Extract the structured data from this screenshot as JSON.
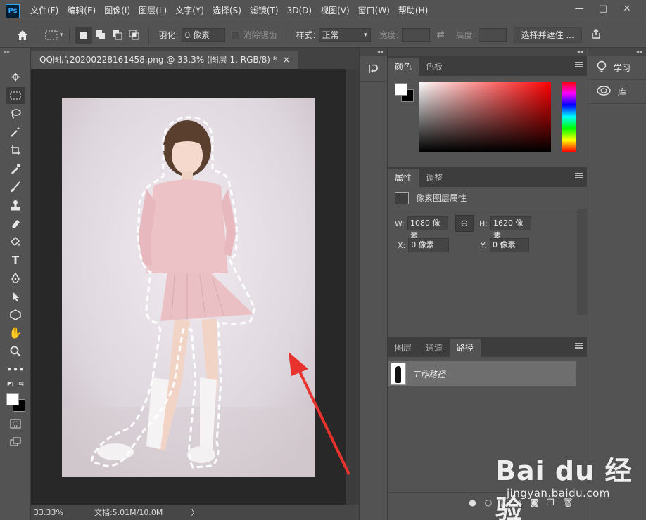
{
  "app": {
    "logo": "Ps",
    "menu": [
      "文件(F)",
      "编辑(E)",
      "图像(I)",
      "图层(L)",
      "文字(Y)",
      "选择(S)",
      "滤镜(T)",
      "3D(D)",
      "视图(V)",
      "窗口(W)",
      "帮助(H)"
    ],
    "window_controls": [
      "—",
      "□",
      "✕"
    ]
  },
  "options": {
    "feather_label": "羽化:",
    "feather_value": "0 像素",
    "antialias_label": "消除锯齿",
    "style_label": "样式:",
    "style_value": "正常",
    "width_label": "宽度:",
    "height_label": "高度:",
    "select_mask_button": "选择并遮住 ..."
  },
  "document": {
    "tab_title": "QQ图片20200228161458.png @ 33.3% (图层 1, RGB/8) *",
    "tab_close": "×",
    "zoom": "33.33%",
    "doc_info": "文档:5.01M/10.0M",
    "status_arrow": "〉"
  },
  "color_panel": {
    "tabs": [
      "颜色",
      "色板"
    ],
    "foreground": "#ffffff",
    "background": "#000000"
  },
  "properties_panel": {
    "tabs": [
      "属性",
      "调整"
    ],
    "header": "像素图层属性",
    "w_label": "W:",
    "w_value": "1080 像素",
    "h_label": "H:",
    "h_value": "1620 像素",
    "x_label": "X:",
    "x_value": "0 像素",
    "y_label": "Y:",
    "y_value": "0 像素"
  },
  "layers_panel": {
    "tabs": [
      "图层",
      "通道",
      "路径"
    ],
    "path_item": "工作路径"
  },
  "side_panel": {
    "learn": "学习",
    "library": "库"
  },
  "watermark": {
    "brand": "Bai du 经验",
    "url": "jingyan.baidu.com"
  },
  "colors": {
    "ui_bg": "#535353",
    "canvas_bg": "#282828",
    "annotation_arrow": "#e8322d"
  }
}
